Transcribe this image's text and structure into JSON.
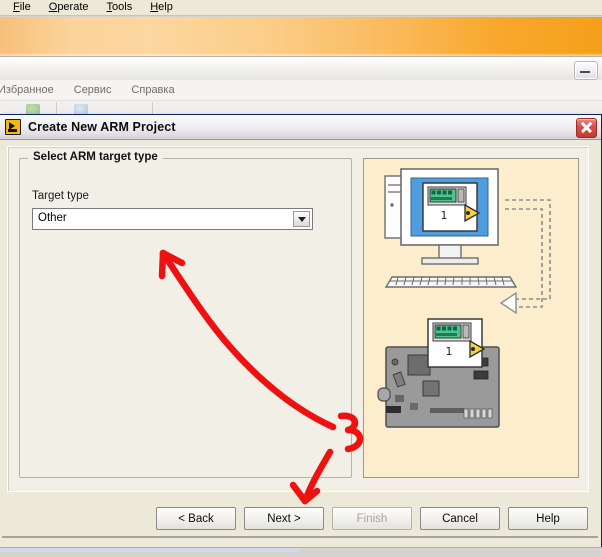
{
  "background_app": {
    "menubar": {
      "items": [
        {
          "label": "File",
          "mnemonic": "F"
        },
        {
          "label": "Operate",
          "mnemonic": "O"
        },
        {
          "label": "Tools",
          "mnemonic": "T"
        },
        {
          "label": "Help",
          "mnemonic": "H"
        }
      ]
    },
    "second_window": {
      "menu_items": [
        "Избранное",
        "Сервис",
        "Справка"
      ],
      "minimize_icon": "minimize-icon"
    }
  },
  "dialog": {
    "title": "Create New ARM Project",
    "icon": "labview-vi-icon",
    "close_icon": "close-icon",
    "group": {
      "legend": "Select ARM target type",
      "field_label": "Target type",
      "combo": {
        "value": "Other",
        "placeholder": "Other",
        "arrow_icon": "chevron-down-icon",
        "options": [
          "Other"
        ]
      }
    },
    "illustration": {
      "alt": "Host computer connected to ARM embedded target board",
      "background_color": "#fceecd",
      "elements": [
        "desktop-monitor",
        "keyboard",
        "vi-front-panel-window",
        "dashed-connection-arrow",
        "arm-target-board",
        "vi-target-window"
      ]
    },
    "buttons": [
      {
        "label": "< Back",
        "name": "back-button",
        "enabled": true
      },
      {
        "label": "Next >",
        "name": "next-button",
        "enabled": true
      },
      {
        "label": "Finish",
        "name": "finish-button",
        "enabled": false
      },
      {
        "label": "Cancel",
        "name": "cancel-button",
        "enabled": true
      },
      {
        "label": "Help",
        "name": "help-button",
        "enabled": true
      }
    ]
  },
  "annotation": {
    "color": "#ee1111",
    "shapes": [
      "arrow-to-combo",
      "squiggle-mark",
      "arrow-down"
    ]
  }
}
